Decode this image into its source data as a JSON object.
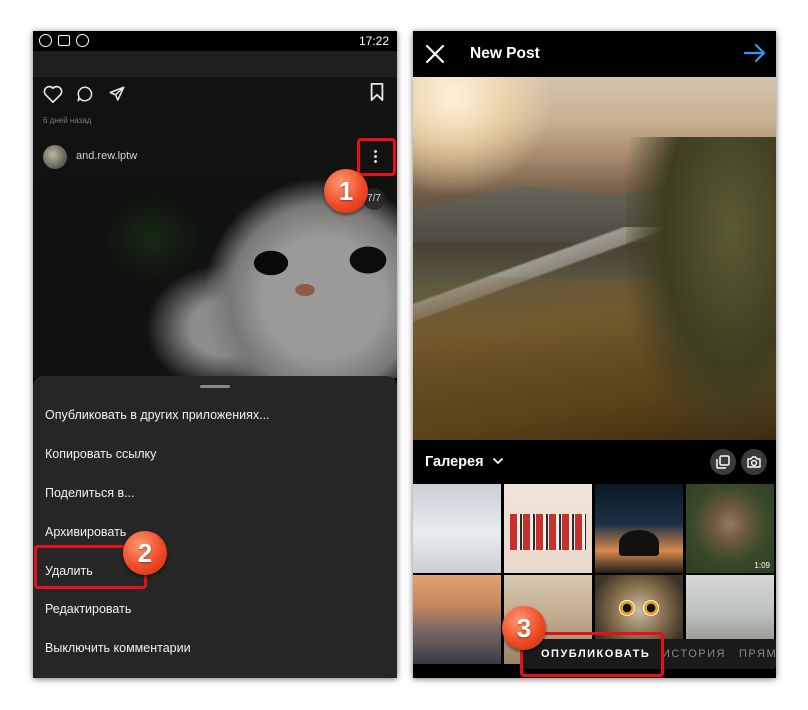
{
  "left_phone": {
    "status_time": "17:22",
    "post_date": "6 дней назад",
    "username": "and.rew.lptw",
    "image_counter": "7/7",
    "menu_items": [
      "Опубликовать в других приложениях...",
      "Копировать ссылку",
      "Поделиться в...",
      "Архивировать",
      "Удалить",
      "Редактировать",
      "Выключить комментарии"
    ]
  },
  "right_phone": {
    "title": "New Post",
    "gallery_label": "Галерея",
    "video_duration": "1:09",
    "modes": [
      "ОПУБЛИКОВАТЬ",
      "ИСТОРИЯ",
      "ПРЯМ"
    ]
  },
  "annotations": [
    "1",
    "2",
    "3"
  ],
  "colors": {
    "highlight": "#e5101a",
    "badge": "#ef4b25",
    "accent_blue": "#3897f0"
  }
}
